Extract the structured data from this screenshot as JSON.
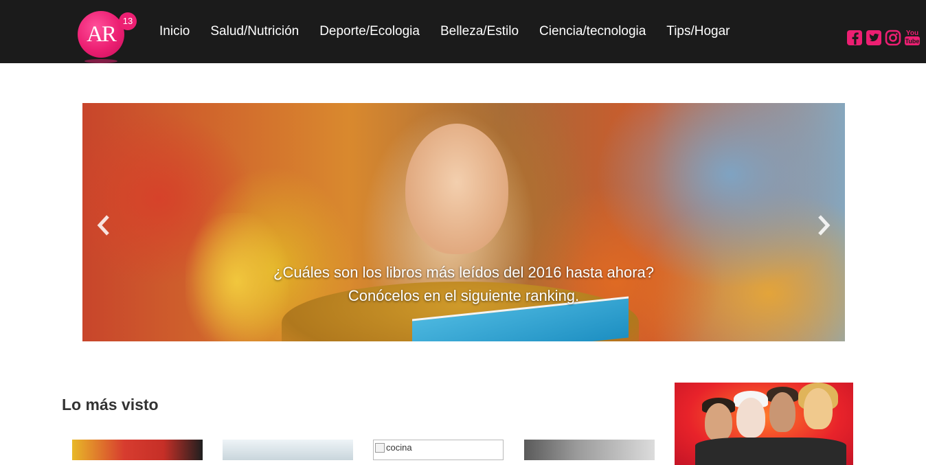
{
  "header": {
    "logo": {
      "text": "AR",
      "badge": "13"
    },
    "nav": [
      {
        "label": "Inicio"
      },
      {
        "label": "Salud/Nutrición"
      },
      {
        "label": "Deporte/Ecologia"
      },
      {
        "label": "Belleza/Estilo"
      },
      {
        "label": "Ciencia/tecnologia"
      },
      {
        "label": "Tips/Hogar"
      }
    ],
    "social": [
      "facebook-icon",
      "twitter-icon",
      "instagram-icon",
      "youtube-icon"
    ],
    "accent_color": "#ec1f72"
  },
  "hero": {
    "caption_line1": "¿Cuáles son los libros más leídos del 2016 hasta ahora?",
    "caption_line2": "Conócelos en el siguiente ranking."
  },
  "most_viewed": {
    "title": "Lo más visto",
    "items": [
      {
        "alt": ""
      },
      {
        "alt": ""
      },
      {
        "alt": "cocina"
      },
      {
        "alt": ""
      }
    ]
  }
}
